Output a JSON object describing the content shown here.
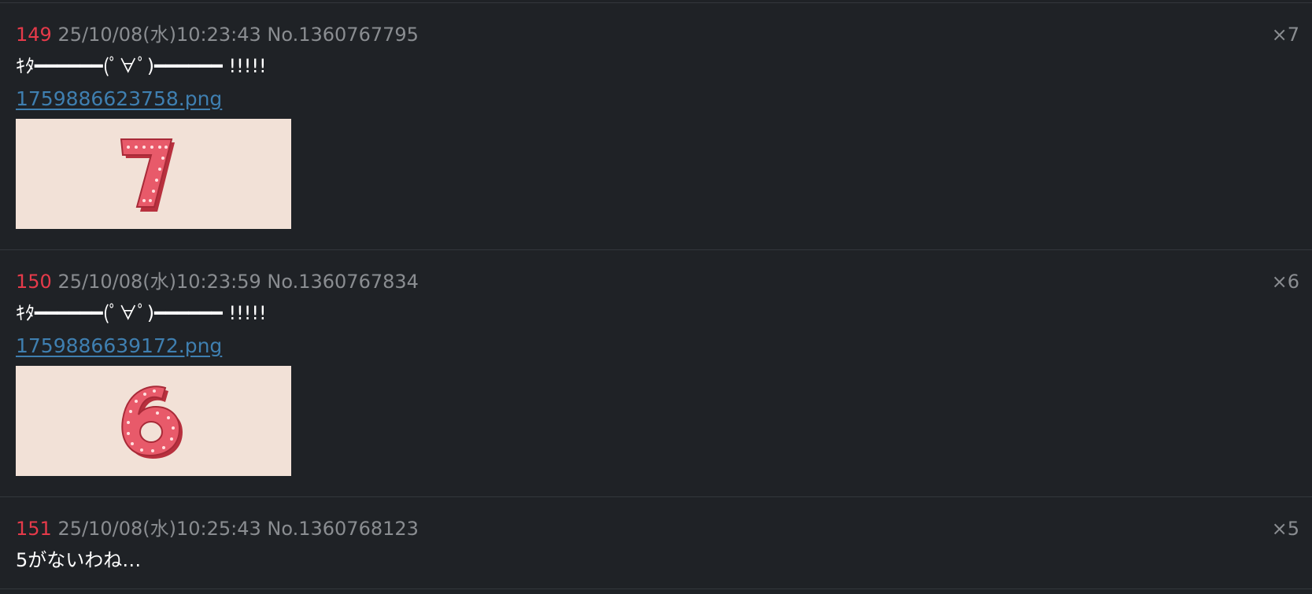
{
  "posts": [
    {
      "number": "149",
      "meta": "25/10/08(水)10:23:43 No.1360767795",
      "count": "×7",
      "text": "ｷﾀ━━━━━━(ﾟ∀ﾟ)━━━━━━ !!!!!",
      "file": "1759886623758.png",
      "thumb_digit": "7"
    },
    {
      "number": "150",
      "meta": "25/10/08(水)10:23:59 No.1360767834",
      "count": "×6",
      "text": "ｷﾀ━━━━━━(ﾟ∀ﾟ)━━━━━━ !!!!!",
      "file": "1759886639172.png",
      "thumb_digit": "6"
    },
    {
      "number": "151",
      "meta": "25/10/08(水)10:25:43 No.1360768123",
      "count": "×5",
      "text": "5がないわね…"
    }
  ],
  "colors": {
    "background": "#1f2226",
    "post_number": "#e63a4a",
    "meta_text": "#8a8d91",
    "link": "#3f7fb0",
    "thumb_bg": "#f2e1d7",
    "digit_fill": "#e85a6a",
    "digit_shadow": "#b8303e"
  }
}
